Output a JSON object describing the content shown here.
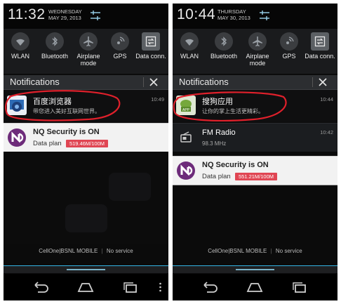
{
  "left": {
    "clock": "11:32",
    "day": "WEDNESDAY",
    "date": "MAY 29, 2013",
    "quick_settings": [
      {
        "label": "WLAN",
        "icon": "wifi-icon"
      },
      {
        "label": "Bluetooth",
        "icon": "bluetooth-icon"
      },
      {
        "label": "Airplane",
        "label2": "mode",
        "icon": "airplane-icon"
      },
      {
        "label": "GPS",
        "icon": "gps-icon"
      },
      {
        "label": "Data conn.",
        "icon": "data-connection-icon"
      }
    ],
    "notifications_title": "Notifications",
    "notifications": [
      {
        "title": "百度浏览器",
        "subtitle": "带您进入美好互联网世界。",
        "time": "10:49",
        "icon": "baidu-browser-icon"
      },
      {
        "title": "NQ Security is ON",
        "data_label": "Data plan",
        "usage": "519.46M/100M",
        "icon": "nq-security-icon"
      }
    ],
    "carrier": "CellOne|BSNL MOBILE",
    "service": "No service"
  },
  "right": {
    "clock": "10:44",
    "day": "THURSDAY",
    "date": "MAY 30, 2013",
    "quick_settings": [
      {
        "label": "WLAN",
        "icon": "wifi-icon"
      },
      {
        "label": "Bluetooth",
        "icon": "bluetooth-icon"
      },
      {
        "label": "Airplane",
        "label2": "mode",
        "icon": "airplane-icon"
      },
      {
        "label": "GPS",
        "icon": "gps-icon"
      },
      {
        "label": "Data conn.",
        "icon": "data-connection-icon"
      }
    ],
    "notifications_title": "Notifications",
    "notifications": [
      {
        "title": "搜狗应用",
        "subtitle": "让你的掌上生活更精彩。",
        "time": "10:44",
        "icon": "sogou-app-icon"
      },
      {
        "title": "FM Radio",
        "subtitle": "98.3 MHz",
        "time": "10:42",
        "icon": "radio-icon"
      },
      {
        "title": "NQ Security is ON",
        "data_label": "Data plan",
        "usage": "551.21M/100M",
        "icon": "nq-security-icon"
      }
    ],
    "carrier": "CellOne|BSNL MOBILE",
    "service": "No service"
  },
  "colors": {
    "accent": "#33b5e5",
    "usage_bar": "#e04653",
    "annotation": "#e0202b",
    "nq_purple": "#6d2b7a"
  }
}
